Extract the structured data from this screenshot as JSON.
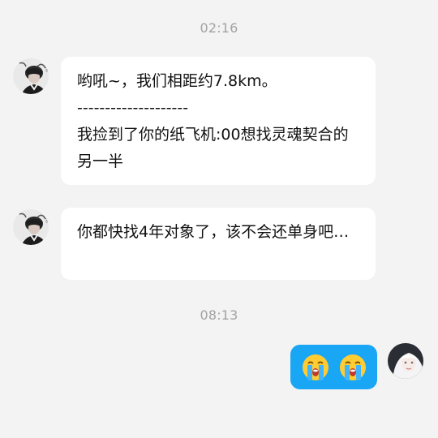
{
  "chat": {
    "time_dividers": [
      "02:16",
      "08:13"
    ],
    "messages": [
      {
        "sender": "other",
        "lines": [
          "哟吼~，我们相距约7.8km。",
          "--------------------",
          "我捡到了你的纸飞机:00想找灵魂契合的另一半"
        ]
      },
      {
        "sender": "other",
        "lines": [
          "你都快找4年对象了，该不会还单身吧…"
        ]
      },
      {
        "sender": "me",
        "emojis": [
          "loudly-crying-face",
          "loudly-crying-face"
        ]
      }
    ]
  },
  "colors": {
    "background": "#f3f3f3",
    "incoming_bubble": "#ffffff",
    "outgoing_bubble": "#19a6f5",
    "timestamp": "#a2a2a2"
  }
}
